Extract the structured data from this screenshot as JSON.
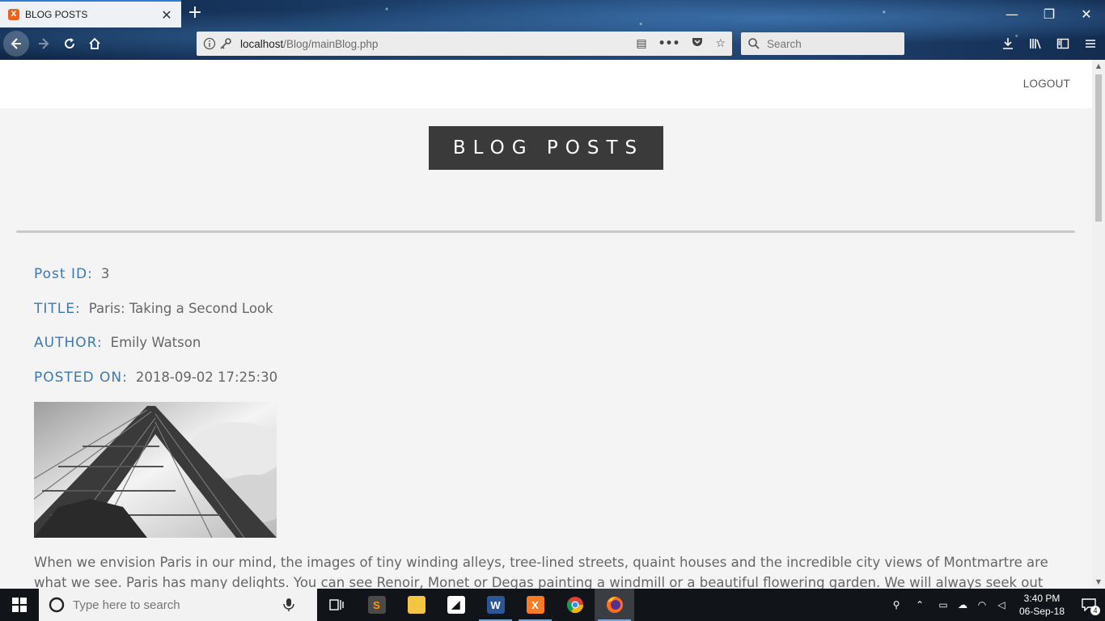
{
  "browser": {
    "tab_title": "BLOG POSTS",
    "tab_favicon_letter": "X",
    "url_host": "localhost",
    "url_path": "/Blog/mainBlog.php",
    "search_placeholder": "Search"
  },
  "page": {
    "logout_label": "LOGOUT",
    "header_title": "BLOG POSTS",
    "post": {
      "id_label": "Post ID:",
      "id_value": "3",
      "title_label": "TITLE:",
      "title_value": "Paris: Taking a Second Look",
      "author_label": "AUTHOR:",
      "author_value": "Emily Watson",
      "posted_label": "POSTED ON:",
      "posted_value": "2018-09-02 17:25:30",
      "image_subject": "eiffel-tower-photo",
      "body": "When we envision Paris in our mind, the images of tiny winding alleys, tree-lined streets, quaint houses and the incredible city views of Montmartre are what we see. Paris has many delights. You can see Renoir, Monet or Degas painting a windmill or a beautiful flowering garden. We will always seek out new and exciting destinations in our"
    }
  },
  "taskbar": {
    "search_placeholder": "Type here to search",
    "apps": [
      "task-view",
      "sublime-text",
      "file-explorer",
      "sticky-notes",
      "word",
      "xampp",
      "chrome",
      "firefox"
    ],
    "time": "3:40 PM",
    "date": "06-Sep-18",
    "notification_count": "4"
  },
  "colors": {
    "label_blue": "#3a79b6",
    "title_box_bg": "#3a3a3a",
    "page_bg": "#f4f4f4"
  }
}
